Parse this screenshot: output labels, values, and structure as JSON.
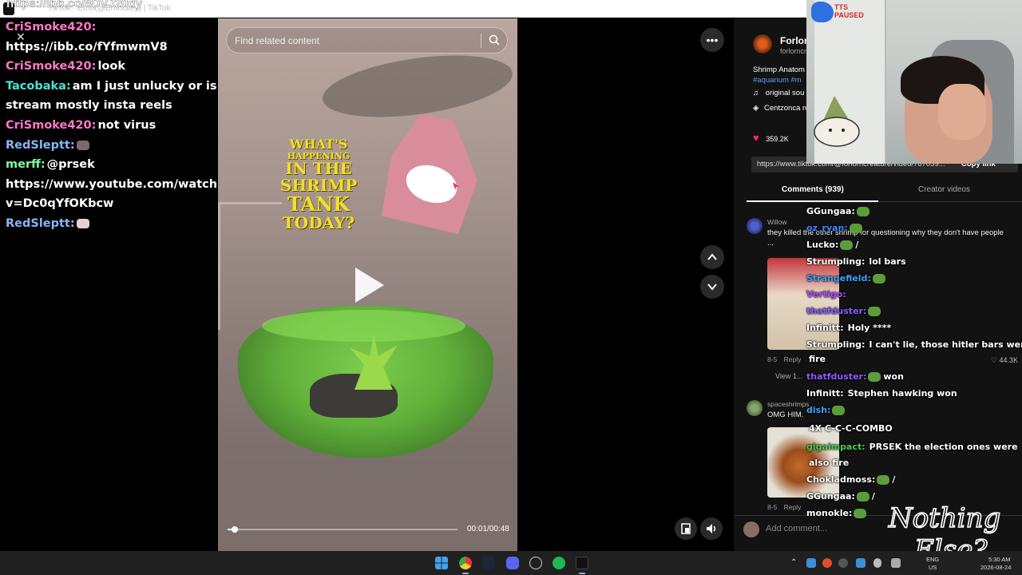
{
  "browser": {
    "tab_title": "TikTok · Errlo(@Errlockey) | TikTok",
    "url_overlay": "https://ibb.co/8DVJ20dy"
  },
  "chat": [
    {
      "user": "CriSmoke420:",
      "color": "#ff79c6",
      "text": ""
    },
    {
      "user": "",
      "color": "#ffffff",
      "text": "https://ibb.co/fYfmwmV8"
    },
    {
      "user": "CriSmoke420:",
      "color": "#ff79c6",
      "text": "look"
    },
    {
      "user": "Tacobaka:",
      "color": "#4be3d6",
      "text": "am I just unlucky or is this"
    },
    {
      "user": "",
      "color": "#ffffff",
      "text": "stream mostly insta reels"
    },
    {
      "user": "CriSmoke420:",
      "color": "#ff79c6",
      "text": "not virus"
    },
    {
      "user": "RedSleptt:",
      "color": "#8ab4f8",
      "text": ""
    },
    {
      "user": "merff:",
      "color": "#7dff9e",
      "text": "@prsek"
    },
    {
      "user": "",
      "color": "#ffffff",
      "text": "https://www.youtube.com/watch?"
    },
    {
      "user": "",
      "color": "#ffffff",
      "text": "v=Dc0qYfOKbcw"
    },
    {
      "user": "RedSleptt:",
      "color": "#8ab4f8",
      "text": ""
    }
  ],
  "video": {
    "search_placeholder": "Find related content",
    "title_lines": [
      "WHAT'S",
      "HAPPENING",
      "IN THE",
      "SHRIMP",
      "TANK",
      "TODAY?"
    ],
    "time": "00:01/00:48",
    "progress": 0.03
  },
  "panel": {
    "author_name": "Forlorn",
    "author_handle": "forlorncr",
    "desc_text": "Shrimp Anatom",
    "desc_tags": "#aquarium #m",
    "music": "original sou",
    "effect": "Centzonca ro",
    "likes": "359.2K",
    "link_url": "https://www.tiktok.com/@forlorncreature/video/767059...",
    "copy_link": "Copy link",
    "tab_comments": "Comments (939)",
    "tab_creator": "Creator videos",
    "comments": [
      {
        "user": "Willow",
        "text": "they killed the other shrimp for questioning why they don't have people ...",
        "date": "8-5",
        "reply": "Reply",
        "likes": "44.3K"
      },
      {
        "user": "spaceshrimps",
        "text": "OMG HIM.",
        "date": "8-5",
        "reply": "Reply",
        "likes": ""
      }
    ],
    "view_replies": "View 1...",
    "add_comment_placeholder": "Add comment..."
  },
  "chat2": [
    {
      "user": "GGungaa:",
      "color": "#ffffff",
      "text": "",
      "pepe": true
    },
    {
      "user": "oz_ryan:",
      "color": "#3d8bff",
      "text": "",
      "pepe": true
    },
    {
      "user": "Lucko:",
      "color": "#ffffff",
      "text": "/",
      "pepe": true
    },
    {
      "user": "Strumpling:",
      "color": "#ffffff",
      "text": "lol bars",
      "pepe": false
    },
    {
      "user": "Strangefield:",
      "color": "#3da5ff",
      "text": "",
      "pepe": true
    },
    {
      "user": "Vertigo:",
      "color": "#b04cff",
      "text": "",
      "pepe": false
    },
    {
      "user": "thatfduster:",
      "color": "#8a5cff",
      "text": "",
      "pepe": true
    },
    {
      "user": "Infinitt:",
      "color": "#ffffff",
      "text": "Holy ****",
      "pepe": false
    },
    {
      "user": "Strumpling:",
      "color": "#ffffff",
      "text": "I can't lie, those hitler bars were",
      "pepe": false
    },
    {
      "user": "",
      "color": "#ffffff",
      "text": "fire",
      "pepe": false
    },
    {
      "user": "thatfduster:",
      "color": "#8a5cff",
      "text": "won",
      "pepe": true
    },
    {
      "user": "Infinitt:",
      "color": "#ffffff",
      "text": "Stephen hawking won",
      "pepe": false
    },
    {
      "user": "dish:",
      "color": "#3da5ff",
      "text": "",
      "pepe": true
    },
    {
      "user": "",
      "color": "#ffffff",
      "text": "4X C-C-C-COMBO",
      "pepe": false
    },
    {
      "user": "gigaimpact:",
      "color": "#4ccc4c",
      "text": "PRSEK the election ones were",
      "pepe": false
    },
    {
      "user": "",
      "color": "#ffffff",
      "text": "also fire",
      "pepe": false
    },
    {
      "user": "Chokladmoss:",
      "color": "#ffffff",
      "text": "/",
      "pepe": true
    },
    {
      "user": "GGungaa:",
      "color": "#ffffff",
      "text": "/",
      "pepe": true
    },
    {
      "user": "monokle:",
      "color": "#ffffff",
      "text": "",
      "pepe": true
    }
  ],
  "webcam": {
    "tts_lines": [
      "TTS",
      "PAUSED"
    ]
  },
  "logo_lines": [
    "Nothing",
    "Else?"
  ],
  "taskbar": {
    "lang": "ENG",
    "region": "US",
    "time": "5:30 AM",
    "date": "2026-08-24"
  }
}
